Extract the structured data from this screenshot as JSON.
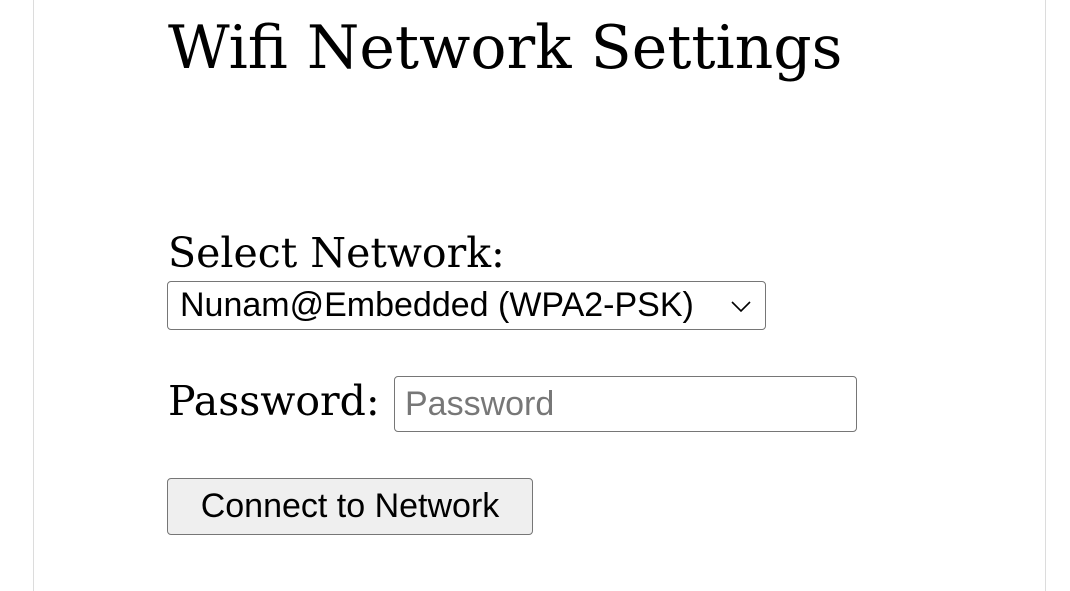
{
  "page": {
    "title": "Wifi Network Settings"
  },
  "network": {
    "label": "Select Network:",
    "selected": "Nunam@Embedded (WPA2-PSK)"
  },
  "password": {
    "label": "Password:",
    "value": "",
    "placeholder": "Password"
  },
  "actions": {
    "connect_label": "Connect to Network"
  },
  "icons": {
    "dropdown": "chevron-down-icon"
  }
}
